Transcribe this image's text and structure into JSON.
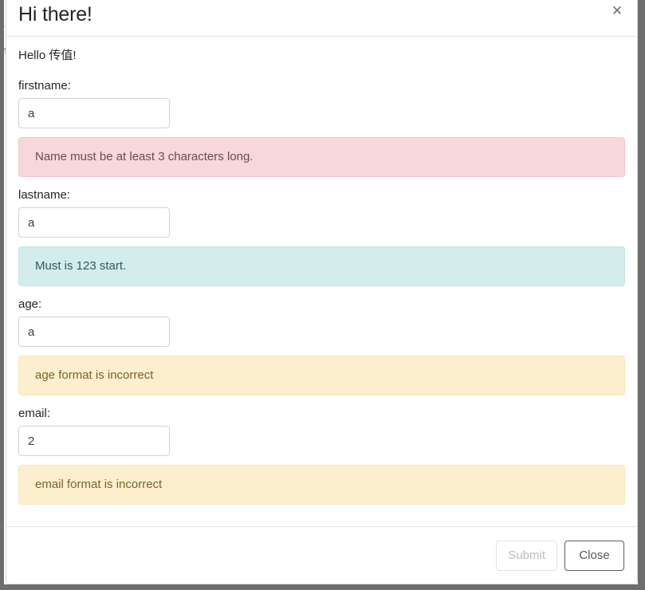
{
  "background": {
    "sliver_text_1": "r",
    "sliver_text_2": "n"
  },
  "modal": {
    "title": "Hi there!",
    "close_icon": "close-icon",
    "close_glyph": "✕",
    "body": {
      "greeting": "Hello 传值!",
      "fields": [
        {
          "label": "firstname:",
          "value": "a",
          "placeholder": "",
          "alert": {
            "text": "Name must be at least 3 characters long.",
            "type": "danger",
            "bg_color": "#f8d7da",
            "text_color": "#6b4a50"
          }
        },
        {
          "label": "lastname:",
          "value": "a",
          "placeholder": "",
          "alert": {
            "text": "Must is 123 start.",
            "type": "info",
            "bg_color": "#d3ecec",
            "text_color": "#2f5b5f"
          }
        },
        {
          "label": "age:",
          "value": "a",
          "placeholder": "",
          "alert": {
            "text": "age format is incorrect",
            "type": "warning",
            "bg_color": "#fcefce",
            "text_color": "#7c6326"
          }
        },
        {
          "label": "email:",
          "value": "2",
          "placeholder": "",
          "alert": {
            "text": "email format is incorrect",
            "type": "warning",
            "bg_color": "#fcefce",
            "text_color": "#7c6326"
          }
        }
      ]
    },
    "footer": {
      "submit_label": "Submit",
      "submit_disabled": true,
      "close_label": "Close"
    }
  }
}
